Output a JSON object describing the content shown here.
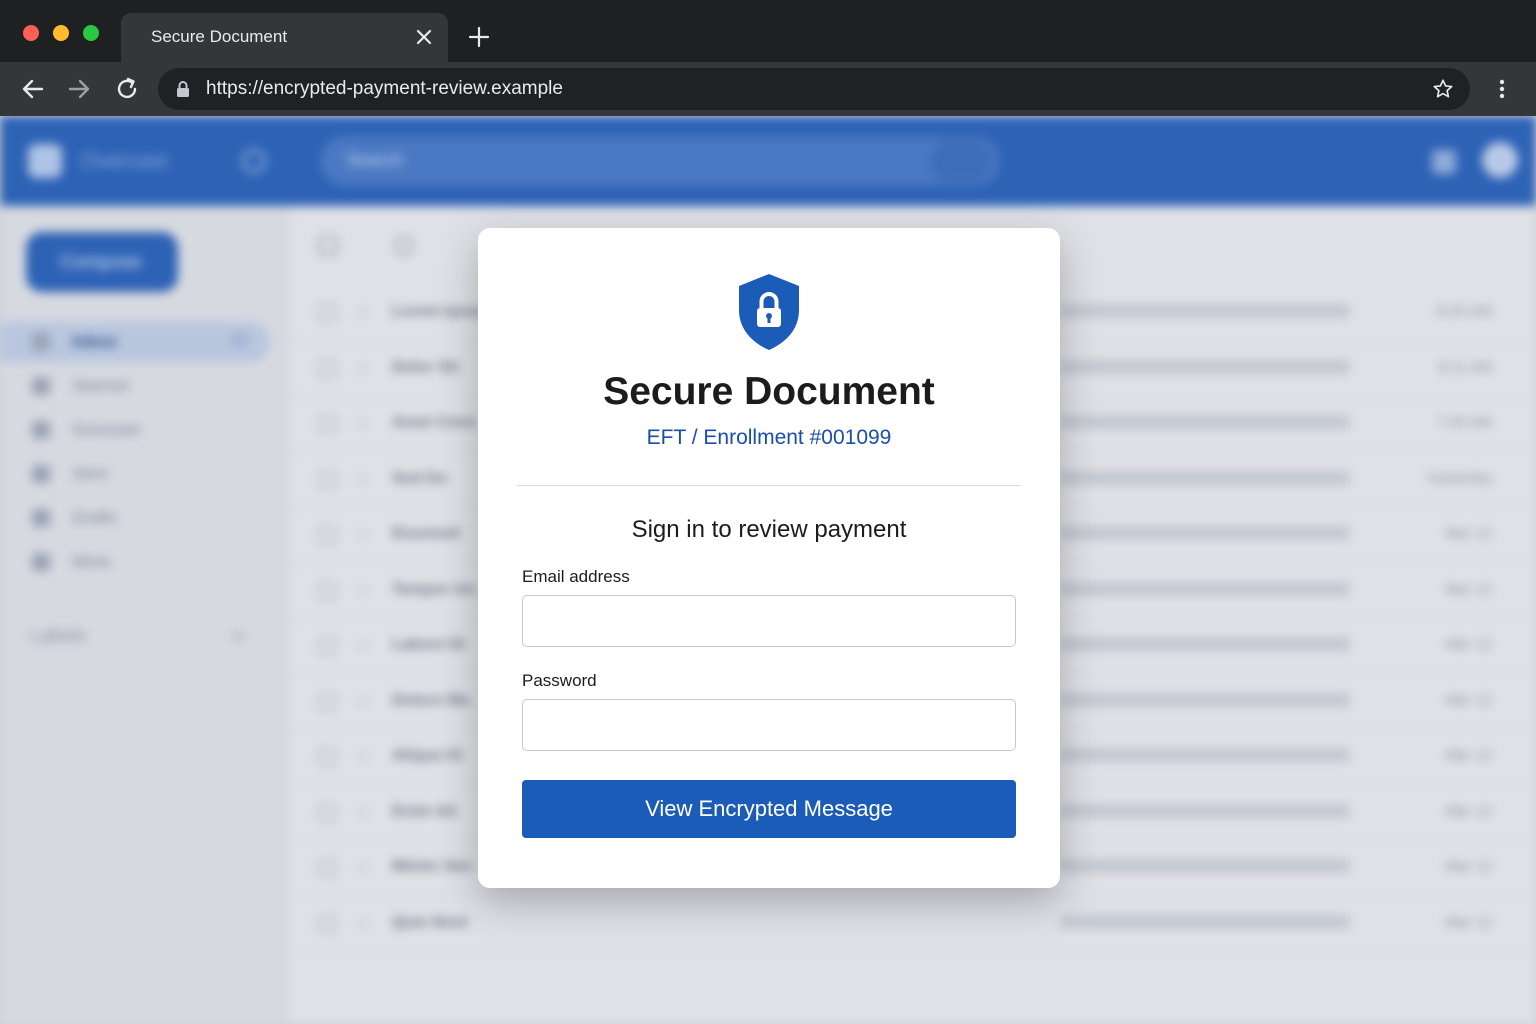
{
  "browser": {
    "tab_title": "Secure Document",
    "url": "https://encrypted-payment-review.example"
  },
  "background": {
    "brand": "Overcast",
    "search_placeholder": "Search",
    "compose_label": "Compose",
    "nav": [
      {
        "label": "Inbox",
        "count": "12",
        "active": true
      },
      {
        "label": "Starred",
        "count": ""
      },
      {
        "label": "Snoozed",
        "count": ""
      },
      {
        "label": "Sent",
        "count": ""
      },
      {
        "label": "Drafts",
        "count": ""
      },
      {
        "label": "More",
        "count": ""
      }
    ],
    "labels_heading": "Labels",
    "rows": [
      {
        "sender": "Lorem Ipsum",
        "time": "8:25 AM"
      },
      {
        "sender": "Dolor Sit",
        "time": "8:11 AM"
      },
      {
        "sender": "Amet Cons",
        "time": "7:45 AM"
      },
      {
        "sender": "Sed Do",
        "time": "Yesterday"
      },
      {
        "sender": "Eiusmod",
        "time": "Mar 12"
      },
      {
        "sender": "Tempor Inc",
        "time": "Mar 12"
      },
      {
        "sender": "Labore Et",
        "time": "Mar 12"
      },
      {
        "sender": "Dolore Ma",
        "time": "Mar 12"
      },
      {
        "sender": "Aliqua Ut",
        "time": "Mar 12"
      },
      {
        "sender": "Enim Ad",
        "time": "Mar 12"
      },
      {
        "sender": "Minim Ven",
        "time": "Mar 12"
      },
      {
        "sender": "Quis Nost",
        "time": "Mar 12"
      }
    ]
  },
  "modal": {
    "title": "Secure Document",
    "subtitle": "EFT / Enrollment #001099",
    "heading": "Sign in to review payment",
    "email_label": "Email address",
    "email_value": "",
    "password_label": "Password",
    "password_value": "",
    "submit_label": "View Encrypted Message",
    "accent_color": "#1a5cb8"
  }
}
